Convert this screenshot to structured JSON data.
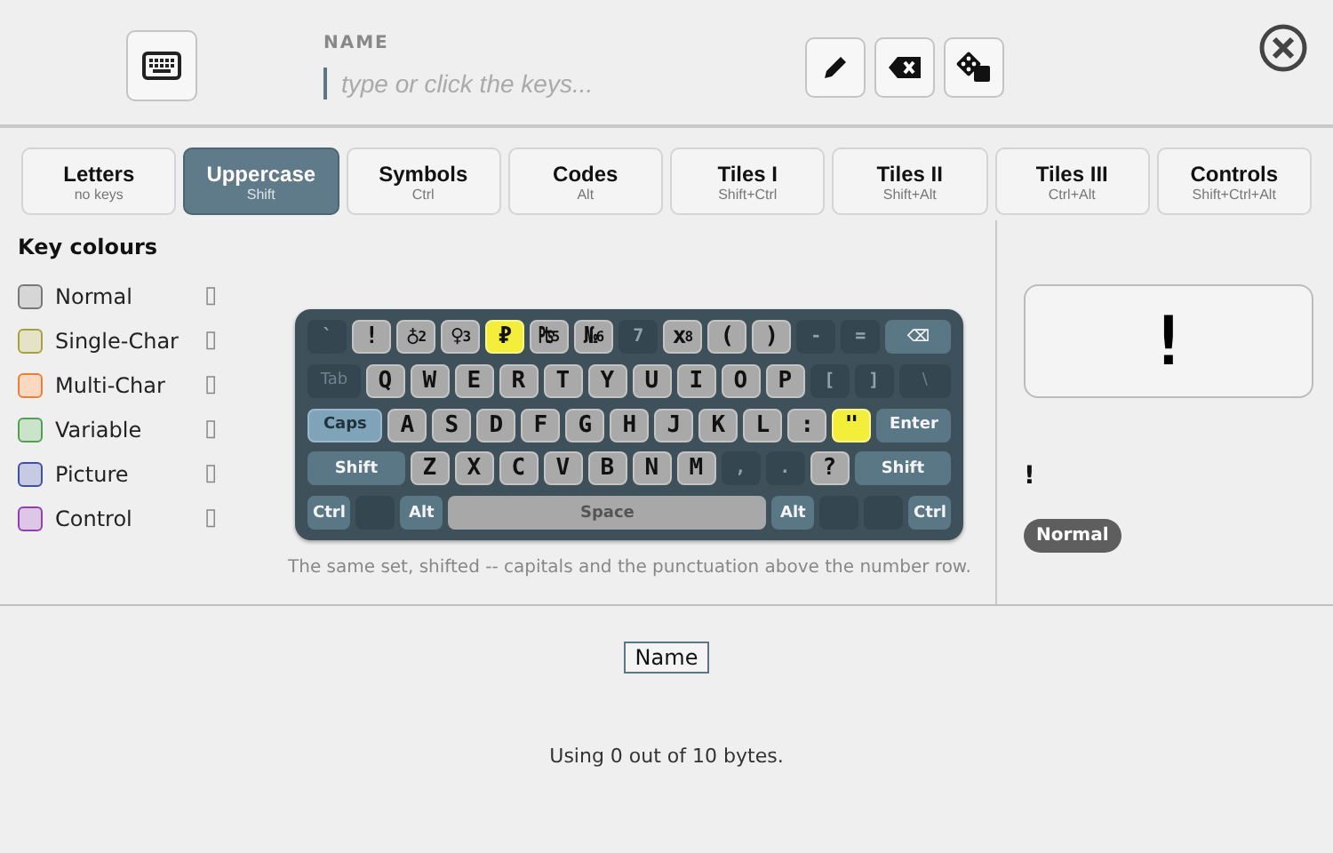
{
  "header": {
    "name_label": "NAME",
    "name_field": {
      "placeholder": "type or click the keys..."
    }
  },
  "tabs": [
    {
      "label": "Letters",
      "hint": "no keys",
      "selected": false
    },
    {
      "label": "Uppercase",
      "hint": "Shift",
      "selected": true
    },
    {
      "label": "Symbols",
      "hint": "Ctrl",
      "selected": false
    },
    {
      "label": "Codes",
      "hint": "Alt",
      "selected": false
    },
    {
      "label": "Tiles I",
      "hint": "Shift+Ctrl",
      "selected": false
    },
    {
      "label": "Tiles II",
      "hint": "Shift+Alt",
      "selected": false
    },
    {
      "label": "Tiles III",
      "hint": "Ctrl+Alt",
      "selected": false
    },
    {
      "label": "Controls",
      "hint": "Shift+Ctrl+Alt",
      "selected": false
    }
  ],
  "legend": {
    "title": "Key colours",
    "items": [
      {
        "name": "Normal",
        "color": "#777777",
        "sample": "▯"
      },
      {
        "name": "Single-Char",
        "color": "#a8a040",
        "sample": "▯"
      },
      {
        "name": "Multi-Char",
        "color": "#f08030",
        "sample": "▯"
      },
      {
        "name": "Variable",
        "color": "#50a050",
        "sample": "▯"
      },
      {
        "name": "Picture",
        "color": "#4050a0",
        "sample": "▯"
      },
      {
        "name": "Control",
        "color": "#9040b0",
        "sample": "▯"
      }
    ]
  },
  "keyboard": {
    "rows": [
      {
        "keys": [
          {
            "kind": "dim",
            "label": "`",
            "pressed": false
          },
          {
            "kind": "char",
            "label": "!",
            "pressed": false
          },
          {
            "kind": "char",
            "label": "♁",
            "sup": "2",
            "pressed": false
          },
          {
            "kind": "char",
            "label": "♀",
            "sup": "3",
            "pressed": false
          },
          {
            "kind": "hl",
            "label": "₽",
            "pressed": false
          },
          {
            "kind": "char",
            "label": "₧",
            "sup": "5",
            "pressed": false
          },
          {
            "kind": "char",
            "label": "№",
            "sup": "6",
            "pressed": false
          },
          {
            "kind": "dim",
            "label": "7",
            "pressed": false
          },
          {
            "kind": "char",
            "label": "x",
            "sup": "8",
            "pressed": false
          },
          {
            "kind": "char",
            "label": "(",
            "pressed": false
          },
          {
            "kind": "char",
            "label": ")",
            "pressed": false
          },
          {
            "kind": "dim",
            "label": "-",
            "pressed": false
          },
          {
            "kind": "dim",
            "label": "=",
            "pressed": false
          },
          {
            "kind": "mod",
            "label": "⌫",
            "pressed": false
          }
        ]
      },
      {
        "keys": [
          {
            "kind": "dimmod",
            "label": "Tab",
            "pressed": false
          },
          {
            "kind": "char",
            "label": "Q",
            "pressed": false
          },
          {
            "kind": "char",
            "label": "W",
            "pressed": false
          },
          {
            "kind": "char",
            "label": "E",
            "pressed": false
          },
          {
            "kind": "char",
            "label": "R",
            "pressed": false
          },
          {
            "kind": "char",
            "label": "T",
            "pressed": false
          },
          {
            "kind": "char",
            "label": "Y",
            "pressed": false
          },
          {
            "kind": "char",
            "label": "U",
            "pressed": false
          },
          {
            "kind": "char",
            "label": "I",
            "pressed": false
          },
          {
            "kind": "char",
            "label": "O",
            "pressed": false
          },
          {
            "kind": "char",
            "label": "P",
            "pressed": false
          },
          {
            "kind": "dim",
            "label": "[",
            "pressed": false
          },
          {
            "kind": "dim",
            "label": "]",
            "pressed": false
          },
          {
            "kind": "dimmod",
            "label": "\\",
            "pressed": false
          }
        ]
      },
      {
        "keys": [
          {
            "kind": "mod",
            "label": "Caps",
            "pressed": true
          },
          {
            "kind": "char",
            "label": "A",
            "pressed": false
          },
          {
            "kind": "char",
            "label": "S",
            "pressed": false
          },
          {
            "kind": "char",
            "label": "D",
            "pressed": false
          },
          {
            "kind": "char",
            "label": "F",
            "pressed": false
          },
          {
            "kind": "char",
            "label": "G",
            "pressed": false
          },
          {
            "kind": "char",
            "label": "H",
            "pressed": false
          },
          {
            "kind": "char",
            "label": "J",
            "pressed": false
          },
          {
            "kind": "char",
            "label": "K",
            "pressed": false
          },
          {
            "kind": "char",
            "label": "L",
            "pressed": false
          },
          {
            "kind": "char",
            "label": ":",
            "pressed": false
          },
          {
            "kind": "hl",
            "label": "\"",
            "pressed": false
          },
          {
            "kind": "mod",
            "label": "Enter",
            "pressed": false
          }
        ]
      },
      {
        "keys": [
          {
            "kind": "mod",
            "label": "Shift",
            "pressed": false
          },
          {
            "kind": "char",
            "label": "Z",
            "pressed": false
          },
          {
            "kind": "char",
            "label": "X",
            "pressed": false
          },
          {
            "kind": "char",
            "label": "C",
            "pressed": false
          },
          {
            "kind": "char",
            "label": "V",
            "pressed": false
          },
          {
            "kind": "char",
            "label": "B",
            "pressed": false
          },
          {
            "kind": "char",
            "label": "N",
            "pressed": false
          },
          {
            "kind": "char",
            "label": "M",
            "pressed": false
          },
          {
            "kind": "dim",
            "label": ",",
            "pressed": false
          },
          {
            "kind": "dim",
            "label": ".",
            "pressed": false
          },
          {
            "kind": "char",
            "label": "?",
            "pressed": false
          },
          {
            "kind": "mod",
            "label": "Shift",
            "pressed": false
          }
        ]
      },
      {
        "keys": [
          {
            "kind": "small",
            "label": "Ctrl",
            "pressed": false
          },
          {
            "kind": "blank",
            "pressed": false
          },
          {
            "kind": "small",
            "label": "Alt",
            "pressed": false
          },
          {
            "kind": "space",
            "label": "Space",
            "pressed": false
          },
          {
            "kind": "small",
            "label": "Alt",
            "pressed": false
          },
          {
            "kind": "blank",
            "pressed": false
          },
          {
            "kind": "blank",
            "pressed": false
          },
          {
            "kind": "small",
            "label": "Ctrl",
            "pressed": false
          }
        ]
      }
    ],
    "caption": "The same set, shifted -- capitals and the punctuation above the number row."
  },
  "preview": {
    "glyph": "!",
    "character": "!",
    "category": "Normal"
  },
  "footer": {
    "name_tag": "Name",
    "usage": "Using 0 out of 10 bytes."
  }
}
